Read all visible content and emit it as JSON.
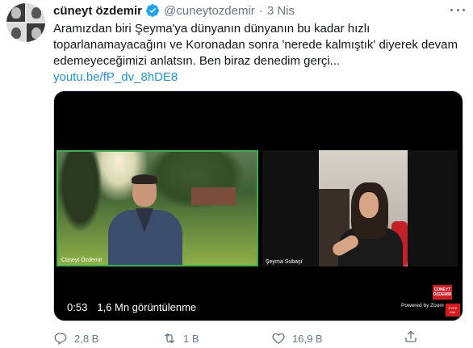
{
  "tweet": {
    "author_name": "cüneyt özdemir",
    "handle": "@cuneytozdemir",
    "separator": "·",
    "date": "3 Nis",
    "text_lines": [
      "Aramızdan biri Şeyma'ya dünyanın dünyanın bu kadar hızlı",
      "toparlanamayacağını ve Koronadan sonra 'nerede kalmıştık' diyerek devam",
      "edemeyeceğimizi anlatsın. Ben biraz denedim gerçi..."
    ],
    "link": "youtu.be/fP_dv_8hDE8"
  },
  "video": {
    "duration": "0:53",
    "views": "1,6 Mn görüntülenme",
    "participant_left": "Cüneyt Özdemir",
    "participant_right": "Şeyma Subaşı",
    "brand_label": "CÜNEYT ÖZDEMİR",
    "powered_by": "Powered by Zoom",
    "brand2_label": "EVDE KAL"
  },
  "actions": {
    "replies": "2,8 B",
    "retweets": "1 B",
    "likes": "16,9 B"
  },
  "colors": {
    "link": "#1b95e0",
    "verified": "#1da1f2",
    "muted": "#657786",
    "active_speaker": "#35b34a"
  },
  "icons": [
    "verified-badge-icon",
    "more-icon",
    "reply-icon",
    "retweet-icon",
    "like-icon",
    "share-icon"
  ]
}
